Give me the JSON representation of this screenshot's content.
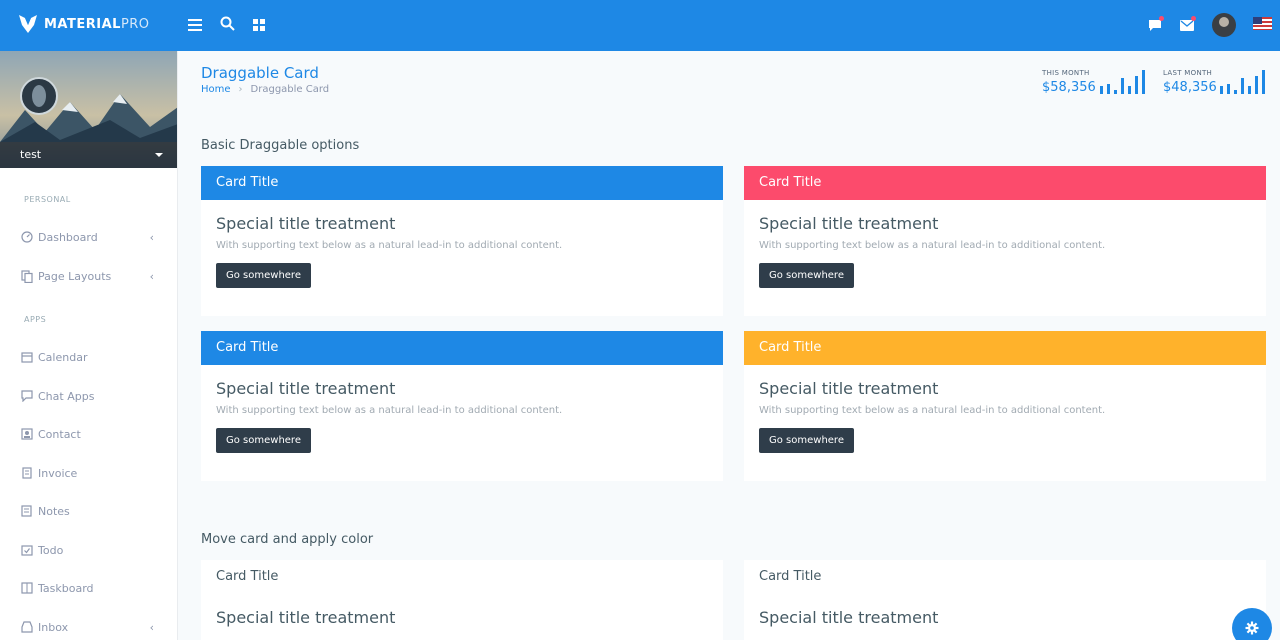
{
  "app": {
    "brand_bold": "MATERIAL",
    "brand_light": "PRO"
  },
  "topbar": {
    "icons": [
      "menu-icon",
      "search-icon",
      "grid-icon",
      "message-icon",
      "mail-icon"
    ],
    "color": "#1e88e5"
  },
  "sidebar": {
    "profile_name": "test",
    "caption_personal": "PERSONAL",
    "caption_apps": "APPS",
    "items": [
      {
        "label": "Dashboard",
        "icon": "gauge-icon",
        "has_chevron": true
      },
      {
        "label": "Page Layouts",
        "icon": "copy-icon",
        "has_chevron": true
      },
      {
        "label": "Calendar",
        "icon": "calendar-icon",
        "has_chevron": false
      },
      {
        "label": "Chat Apps",
        "icon": "chat-icon",
        "has_chevron": false
      },
      {
        "label": "Contact",
        "icon": "contact-icon",
        "has_chevron": false
      },
      {
        "label": "Invoice",
        "icon": "invoice-icon",
        "has_chevron": false
      },
      {
        "label": "Notes",
        "icon": "notes-icon",
        "has_chevron": false
      },
      {
        "label": "Todo",
        "icon": "todo-icon",
        "has_chevron": false
      },
      {
        "label": "Taskboard",
        "icon": "taskboard-icon",
        "has_chevron": false
      },
      {
        "label": "Inbox",
        "icon": "inbox-icon",
        "has_chevron": true
      }
    ]
  },
  "header": {
    "title": "Draggable Card",
    "breadcrumb_home": "Home",
    "breadcrumb_current": "Draggable Card",
    "this_month_label": "THIS MONTH",
    "this_month_value": "$58,356",
    "last_month_label": "LAST MONTH",
    "last_month_value": "$48,356"
  },
  "section1": {
    "title": "Basic Draggable options",
    "cards": [
      {
        "header": "Card Title",
        "title": "Special title treatment",
        "text": "With supporting text below as a natural lead-in to additional content.",
        "button": "Go somewhere",
        "color": "#1e88e5"
      },
      {
        "header": "Card Title",
        "title": "Special title treatment",
        "text": "With supporting text below as a natural lead-in to additional content.",
        "button": "Go somewhere",
        "color": "#fc4b6c"
      },
      {
        "header": "Card Title",
        "title": "Special title treatment",
        "text": "With supporting text below as a natural lead-in to additional content.",
        "button": "Go somewhere",
        "color": "#1e88e5"
      },
      {
        "header": "Card Title",
        "title": "Special title treatment",
        "text": "With supporting text below as a natural lead-in to additional content.",
        "button": "Go somewhere",
        "color": "#ffb22b"
      }
    ]
  },
  "section2": {
    "title": "Move card and apply color",
    "cards": [
      {
        "header": "Card Title",
        "title": "Special title treatment"
      },
      {
        "header": "Card Title",
        "title": "Special title treatment"
      }
    ]
  },
  "fab_icon": "gear-icon"
}
